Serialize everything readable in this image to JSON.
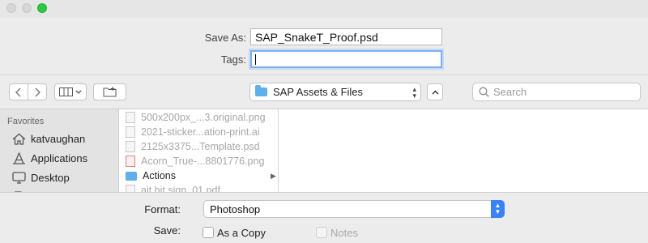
{
  "dialog": {
    "save_as_label": "Save As:",
    "save_as_value": "SAP_SnakeT_Proof.psd",
    "tags_label": "Tags:",
    "tags_value": ""
  },
  "toolbar": {
    "back_icon": "chevron-left-icon",
    "forward_icon": "chevron-right-icon",
    "location": "SAP Assets & Files",
    "search_placeholder": "Search"
  },
  "sidebar": {
    "heading": "Favorites",
    "items": [
      {
        "label": "katvaughan",
        "icon": "home-icon"
      },
      {
        "label": "Applications",
        "icon": "applications-icon"
      },
      {
        "label": "Desktop",
        "icon": "desktop-icon"
      }
    ]
  },
  "files": [
    {
      "name": "500x200px_...3.original.png",
      "dir": false
    },
    {
      "name": "2021-sticker...ation-print.ai",
      "dir": false
    },
    {
      "name": "2125x3375...Template.psd",
      "dir": false
    },
    {
      "name": "Acorn_True-...8801776.png",
      "dir": false
    },
    {
      "name": "Actions",
      "dir": true
    },
    {
      "name": "ait bit sign_01.pdf",
      "dir": false
    }
  ],
  "options": {
    "format_label": "Format:",
    "format_value": "Photoshop",
    "save_label": "Save:",
    "as_copy_label": "As a Copy",
    "notes_label": "Notes"
  },
  "colors": {
    "accent": "#3a82f7",
    "zoom_button": "#2ac940",
    "folder": "#5fb0ea"
  }
}
